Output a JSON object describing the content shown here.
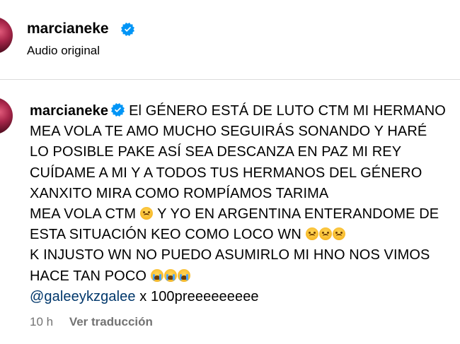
{
  "header": {
    "username": "marcianeke",
    "subtitle": "Audio original"
  },
  "comment": {
    "username": "marcianeke",
    "lines": [
      "El GÉNERO ESTÁ DE LUTO CTM MI HERMANO",
      "MEA VOLA TE AMO MUCHO SEGUIRÁS SONANDO Y HARÉ",
      "LO POSIBLE PAKE ASÍ SEA DESCANZA EN PAZ MI REY",
      "CUÍDAME A MI Y A TODOS TUS HERMANOS DEL GÉNERO",
      "XANXITO MIRA COMO ROMPÍAMOS TARIMA",
      "MEA VOLA CTM",
      "Y YO EN ARGENTINA ENTERANDOME DE",
      "ESTA SITUACIÓN KEO COMO LOCO WN",
      "K INJUSTO WN NO PUEDO ASUMIRLO MI HNO NOS VIMOS",
      "HACE TAN POCO"
    ],
    "mention": "@galeeykzgalee",
    "mention_suffix": " x 100preeeeeeeee"
  },
  "meta": {
    "time": "10 h",
    "translate_label": "Ver traducción"
  },
  "colors": {
    "verified": "#0095f6",
    "mention": "#00376b",
    "muted": "#737373",
    "divider": "#dbdbdb"
  },
  "icons": {
    "verified": "verified-badge-icon",
    "sad": "disappointed-face-emoji",
    "cry": "loudly-crying-face-emoji"
  }
}
